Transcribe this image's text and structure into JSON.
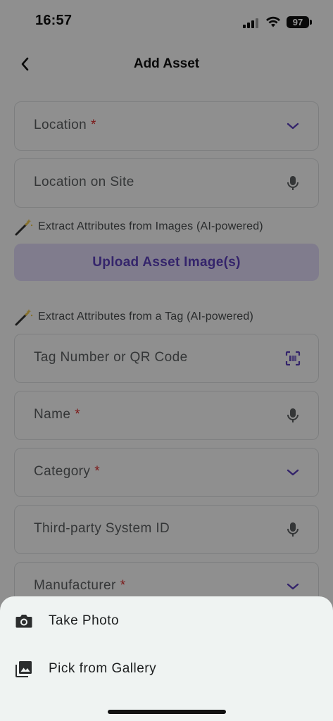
{
  "status_bar": {
    "time": "16:57",
    "battery": "97"
  },
  "header": {
    "title": "Add Asset"
  },
  "form": {
    "location": {
      "label": "Location",
      "required_mark": "*"
    },
    "location_on_site": {
      "label": "Location on Site"
    },
    "image_hint": "Extract Attributes from Images (AI-powered)",
    "upload_button": "Upload Asset Image(s)",
    "tag_hint": "Extract Attributes from a Tag (AI-powered)",
    "tag_number": {
      "label": "Tag Number or QR Code"
    },
    "name": {
      "label": "Name",
      "required_mark": "*"
    },
    "category": {
      "label": "Category",
      "required_mark": "*"
    },
    "third_party_id": {
      "label": "Third-party System ID"
    },
    "manufacturer": {
      "label": "Manufacturer",
      "required_mark": "*"
    }
  },
  "sheet": {
    "items": [
      {
        "label": "Take Photo",
        "icon": "camera-icon"
      },
      {
        "label": "Pick from Gallery",
        "icon": "gallery-icon"
      }
    ]
  },
  "colors": {
    "accent": "#5a3fb8",
    "upload_bg": "#dcd6f3",
    "required": "#d62b2b",
    "sheet_bg": "#eff3f2"
  }
}
